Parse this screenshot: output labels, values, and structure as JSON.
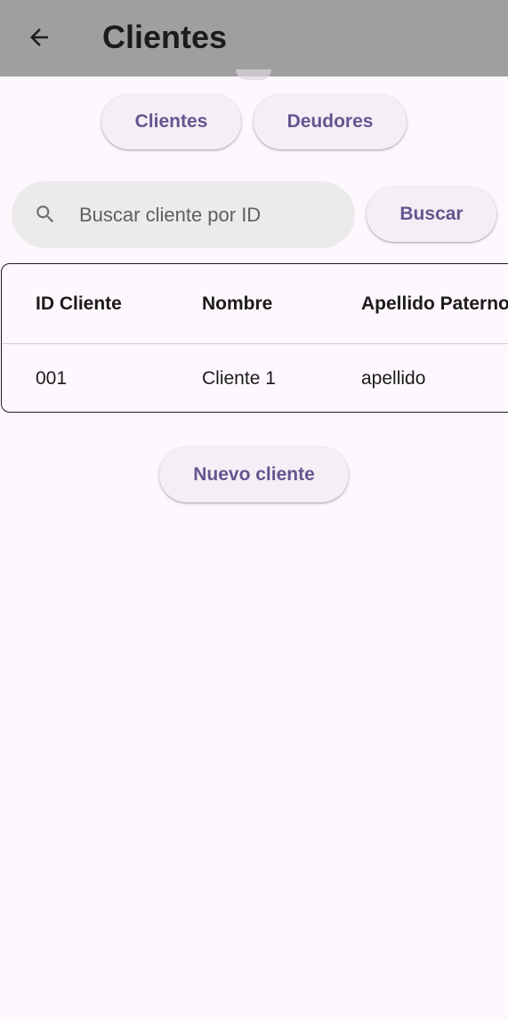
{
  "appbar": {
    "title": "Clientes",
    "back_icon": "arrow-left-icon",
    "background": "#9f9f9f"
  },
  "tabs": {
    "clientes_label": "Clientes",
    "deudores_label": "Deudores"
  },
  "search": {
    "icon": "search-icon",
    "placeholder": "Buscar cliente por ID",
    "value": "",
    "button_label": "Buscar"
  },
  "table": {
    "columns": [
      "ID Cliente",
      "Nombre",
      "Apellido Paterno"
    ],
    "rows": [
      [
        "001",
        "Cliente 1",
        "apellido"
      ]
    ]
  },
  "actions": {
    "new_client_label": "Nuevo cliente"
  },
  "colors": {
    "accent": "#65558f",
    "page_background": "#fef7fe",
    "button_background": "#f6eef6",
    "search_background": "#ebebeb"
  }
}
